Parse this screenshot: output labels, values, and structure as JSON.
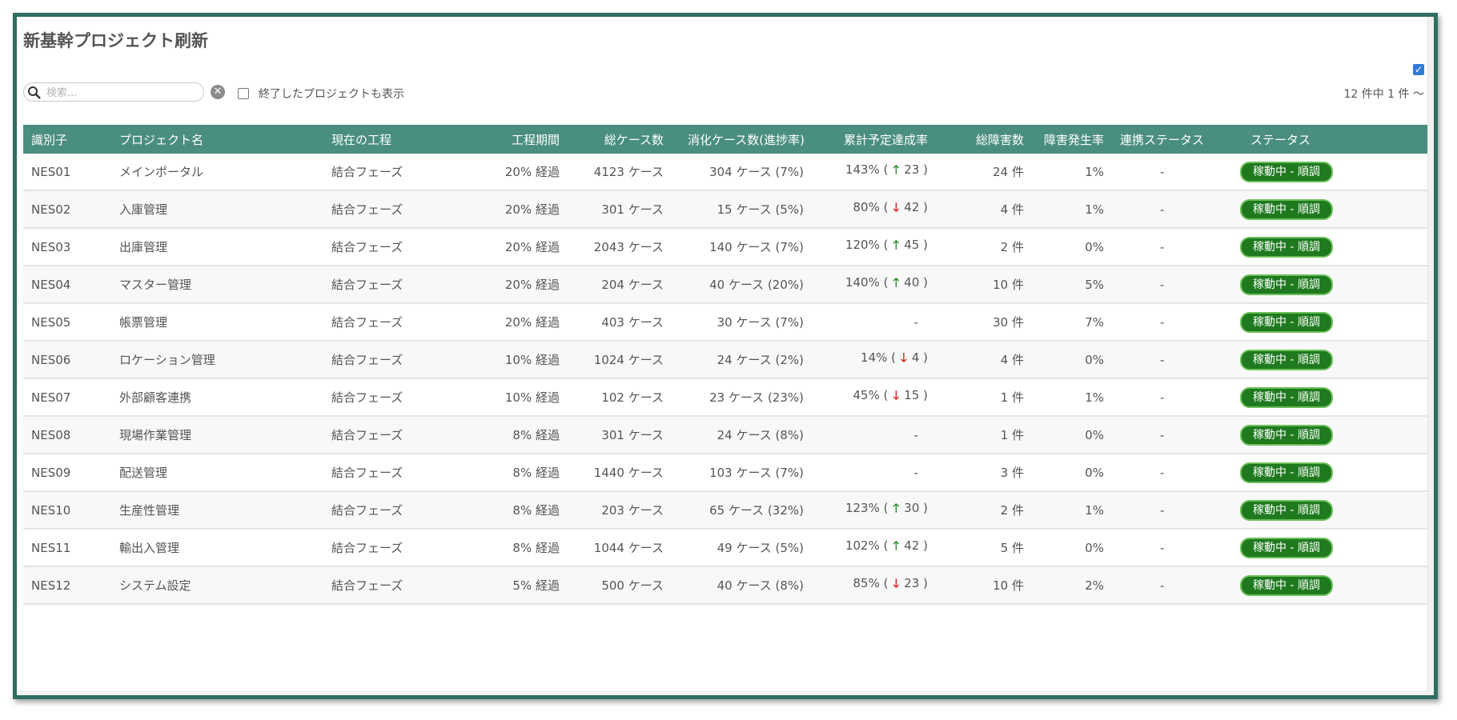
{
  "page": {
    "title": "新基幹プロジェクト刷新"
  },
  "toolbar": {
    "search_placeholder": "検索...",
    "show_ended_label": "終了したプロジェクトも表示",
    "count_text": "12 件中 1 件 〜"
  },
  "table": {
    "headers": [
      "識別子",
      "プロジェクト名",
      "現在の工程",
      "工程期間",
      "総ケース数",
      "消化ケース数(進捗率)",
      "累計予定達成率",
      "総障害数",
      "障害発生率",
      "連携ステータス",
      "ステータス"
    ],
    "rows": [
      {
        "id": "NES01",
        "name": "メインポータル",
        "phase": "結合フェーズ",
        "period": "20% 経過",
        "total": "4123 ケース",
        "done": "304 ケース (7%)",
        "rate": "143% (",
        "dir": "up",
        "diff": "23 )",
        "bugs": "24 件",
        "bug_rate": "1%",
        "link": "-",
        "status": "稼動中 - 順調"
      },
      {
        "id": "NES02",
        "name": "入庫管理",
        "phase": "結合フェーズ",
        "period": "20% 経過",
        "total": "301 ケース",
        "done": "15 ケース (5%)",
        "rate": "80% (",
        "dir": "down",
        "diff": "42 )",
        "bugs": "4 件",
        "bug_rate": "1%",
        "link": "-",
        "status": "稼動中 - 順調"
      },
      {
        "id": "NES03",
        "name": "出庫管理",
        "phase": "結合フェーズ",
        "period": "20% 経過",
        "total": "2043 ケース",
        "done": "140 ケース (7%)",
        "rate": "120% (",
        "dir": "up",
        "diff": "45 )",
        "bugs": "2 件",
        "bug_rate": "0%",
        "link": "-",
        "status": "稼動中 - 順調"
      },
      {
        "id": "NES04",
        "name": "マスター管理",
        "phase": "結合フェーズ",
        "period": "20% 経過",
        "total": "204 ケース",
        "done": "40 ケース (20%)",
        "rate": "140% (",
        "dir": "up",
        "diff": "40 )",
        "bugs": "10 件",
        "bug_rate": "5%",
        "link": "-",
        "status": "稼動中 - 順調"
      },
      {
        "id": "NES05",
        "name": "帳票管理",
        "phase": "結合フェーズ",
        "period": "20% 経過",
        "total": "403 ケース",
        "done": "30 ケース (7%)",
        "rate": "-",
        "dir": "",
        "diff": "",
        "bugs": "30 件",
        "bug_rate": "7%",
        "link": "-",
        "status": "稼動中 - 順調"
      },
      {
        "id": "NES06",
        "name": "ロケーション管理",
        "phase": "結合フェーズ",
        "period": "10% 経過",
        "total": "1024 ケース",
        "done": "24 ケース (2%)",
        "rate": "14% (",
        "dir": "down",
        "diff": "4 )",
        "bugs": "4 件",
        "bug_rate": "0%",
        "link": "-",
        "status": "稼動中 - 順調"
      },
      {
        "id": "NES07",
        "name": "外部顧客連携",
        "phase": "結合フェーズ",
        "period": "10% 経過",
        "total": "102 ケース",
        "done": "23 ケース (23%)",
        "rate": "45% (",
        "dir": "down",
        "diff": "15 )",
        "bugs": "1 件",
        "bug_rate": "1%",
        "link": "-",
        "status": "稼動中 - 順調"
      },
      {
        "id": "NES08",
        "name": "現場作業管理",
        "phase": "結合フェーズ",
        "period": "8% 経過",
        "total": "301 ケース",
        "done": "24 ケース (8%)",
        "rate": "-",
        "dir": "",
        "diff": "",
        "bugs": "1 件",
        "bug_rate": "0%",
        "link": "-",
        "status": "稼動中 - 順調"
      },
      {
        "id": "NES09",
        "name": "配送管理",
        "phase": "結合フェーズ",
        "period": "8% 経過",
        "total": "1440 ケース",
        "done": "103 ケース (7%)",
        "rate": "-",
        "dir": "",
        "diff": "",
        "bugs": "3 件",
        "bug_rate": "0%",
        "link": "-",
        "status": "稼動中 - 順調"
      },
      {
        "id": "NES10",
        "name": "生産性管理",
        "phase": "結合フェーズ",
        "period": "8% 経過",
        "total": "203 ケース",
        "done": "65 ケース (32%)",
        "rate": "123% (",
        "dir": "up",
        "diff": "30 )",
        "bugs": "2 件",
        "bug_rate": "1%",
        "link": "-",
        "status": "稼動中 - 順調"
      },
      {
        "id": "NES11",
        "name": "輸出入管理",
        "phase": "結合フェーズ",
        "period": "8% 経過",
        "total": "1044 ケース",
        "done": "49 ケース (5%)",
        "rate": "102% (",
        "dir": "up",
        "diff": "42 )",
        "bugs": "5 件",
        "bug_rate": "0%",
        "link": "-",
        "status": "稼動中 - 順調"
      },
      {
        "id": "NES12",
        "name": "システム設定",
        "phase": "結合フェーズ",
        "period": "5% 経過",
        "total": "500 ケース",
        "done": "40 ケース (8%)",
        "rate": "85% (",
        "dir": "down",
        "diff": "23 )",
        "bugs": "10 件",
        "bug_rate": "2%",
        "link": "-",
        "status": "稼動中 - 順調"
      }
    ]
  },
  "colors": {
    "header_bg": "#4a8e80",
    "frame_border": "#2f6e62",
    "badge_bg": "#1f7a1f",
    "arrow_up": "#2e8b2e",
    "arrow_down": "#e02424"
  },
  "icons": {
    "up": "up-arrow-icon",
    "down": "down-arrow-icon",
    "search": "search-icon",
    "clear": "clear-icon"
  }
}
